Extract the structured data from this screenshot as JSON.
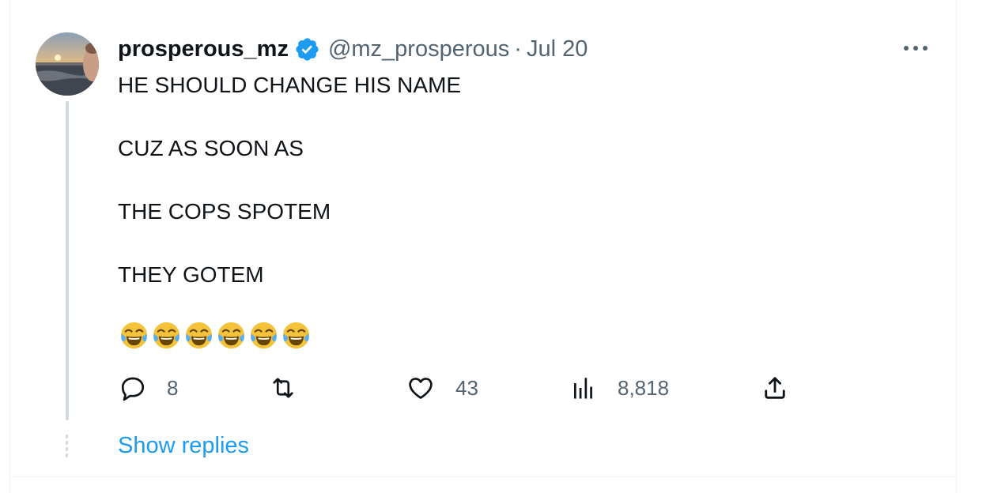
{
  "tweet": {
    "author": {
      "display_name": "prosperous_mz",
      "handle": "@mz_prosperous",
      "verified": true,
      "avatar_icon": "avatar-sunset-photo"
    },
    "separator": "·",
    "date": "Jul 20",
    "lines": [
      "HE SHOULD CHANGE HIS NAME",
      "CUZ AS SOON AS",
      "THE COPS SPOTEM",
      "THEY GOTEM"
    ],
    "emoji": [
      "😂",
      "😂",
      "😂",
      "😂",
      "😂",
      "😂"
    ],
    "stats": {
      "replies": "8",
      "retweets": "",
      "likes": "43",
      "views": "8,818"
    }
  },
  "thread": {
    "show_replies_label": "Show replies"
  },
  "colors": {
    "text": "#0f1419",
    "muted": "#536471",
    "accent": "#1d9bf0",
    "verified_badge": "#1d9bf0",
    "thread_line": "#cfd9de",
    "border": "#eff3f4"
  },
  "icons": {
    "reply": "speech-bubble-icon",
    "retweet": "retweet-arrows-icon",
    "like": "heart-icon",
    "views": "bar-chart-icon",
    "share": "upload-share-icon",
    "more": "more-dots-icon",
    "verified": "verified-badge-icon"
  }
}
